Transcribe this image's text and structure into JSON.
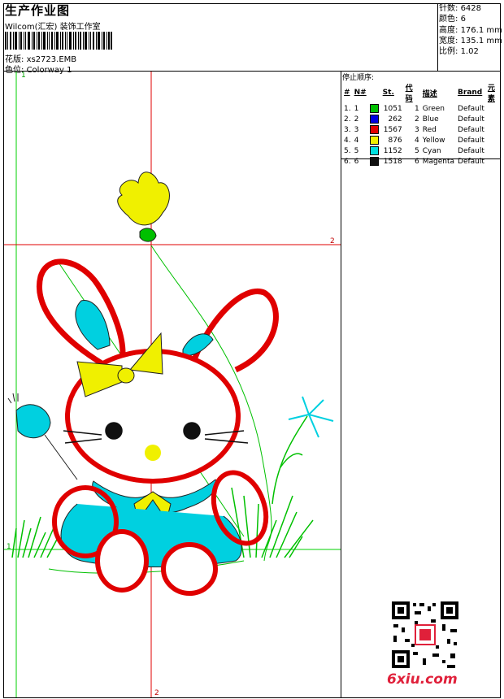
{
  "header": {
    "title": "生产作业图",
    "company": "Wilcom(汇宏) 装饰工作室",
    "file_label": "花版:",
    "file_value": "xs2723.EMB",
    "colorway_label": "色位:",
    "colorway_value": "Colorway 1"
  },
  "stats": {
    "stitches_label": "针数:",
    "stitches_value": "6428",
    "colors_label": "颜色:",
    "colors_value": "6",
    "height_label": "高度:",
    "height_value": "176.1 mm",
    "width_label": "宽度:",
    "width_value": "135.1 mm",
    "scale_label": "比例:",
    "scale_value": "1.02"
  },
  "sequence": {
    "title": "停止顺序:",
    "headers": [
      "#",
      "N#",
      "St.",
      "代码",
      "描述",
      "Brand",
      "元素"
    ],
    "rows": [
      {
        "idx": "1.",
        "n": "1",
        "color": "#00c000",
        "st": "1051",
        "code": "1",
        "desc": "Green",
        "brand": "Default"
      },
      {
        "idx": "2.",
        "n": "2",
        "color": "#0000e0",
        "st": "262",
        "code": "2",
        "desc": "Blue",
        "brand": "Default"
      },
      {
        "idx": "3.",
        "n": "3",
        "color": "#e00000",
        "st": "1567",
        "code": "3",
        "desc": "Red",
        "brand": "Default"
      },
      {
        "idx": "4.",
        "n": "4",
        "color": "#f0f000",
        "st": "876",
        "code": "4",
        "desc": "Yellow",
        "brand": "Default"
      },
      {
        "idx": "5.",
        "n": "5",
        "color": "#00e0e0",
        "st": "1152",
        "code": "5",
        "desc": "Cyan",
        "brand": "Default"
      },
      {
        "idx": "6.",
        "n": "6",
        "color": "#101010",
        "st": "1518",
        "code": "6",
        "desc": "Magenta",
        "brand": "Default"
      }
    ]
  },
  "guides": {
    "v1_label": "1",
    "h1_label": "1",
    "h2_label": "2",
    "v2_label": "2"
  },
  "watermark": {
    "site": "6xiu.com"
  },
  "colors": {
    "guide_green": "#00d000",
    "guide_red": "#e00000"
  }
}
